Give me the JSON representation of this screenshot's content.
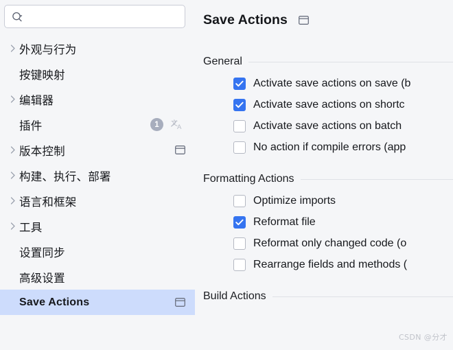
{
  "colors": {
    "background": "#f5f6f8",
    "selection": "#cddcfc",
    "accent": "#3574f0",
    "rule": "#dfe1e6",
    "badge": "#a7adbd",
    "text": "#16181c"
  },
  "sidebar": {
    "search": {
      "value": "",
      "placeholder": "",
      "icon": "search-icon",
      "dropdown_icon": "caret-down-icon"
    },
    "items": [
      {
        "label": "外观与行为",
        "expandable": true,
        "selected": false,
        "badge": null,
        "translate_icon": false,
        "panel_icon": false
      },
      {
        "label": "按键映射",
        "expandable": false,
        "selected": false,
        "badge": null,
        "translate_icon": false,
        "panel_icon": false
      },
      {
        "label": "编辑器",
        "expandable": true,
        "selected": false,
        "badge": null,
        "translate_icon": false,
        "panel_icon": false
      },
      {
        "label": "插件",
        "expandable": false,
        "selected": false,
        "badge": "1",
        "translate_icon": true,
        "panel_icon": false
      },
      {
        "label": "版本控制",
        "expandable": true,
        "selected": false,
        "badge": null,
        "translate_icon": false,
        "panel_icon": true
      },
      {
        "label": "构建、执行、部署",
        "expandable": true,
        "selected": false,
        "badge": null,
        "translate_icon": false,
        "panel_icon": false
      },
      {
        "label": "语言和框架",
        "expandable": true,
        "selected": false,
        "badge": null,
        "translate_icon": false,
        "panel_icon": false
      },
      {
        "label": "工具",
        "expandable": true,
        "selected": false,
        "badge": null,
        "translate_icon": false,
        "panel_icon": false
      },
      {
        "label": "设置同步",
        "expandable": false,
        "selected": false,
        "badge": null,
        "translate_icon": false,
        "panel_icon": false
      },
      {
        "label": "高级设置",
        "expandable": false,
        "selected": false,
        "badge": null,
        "translate_icon": false,
        "panel_icon": false
      },
      {
        "label": "Save Actions",
        "expandable": false,
        "selected": true,
        "badge": null,
        "translate_icon": false,
        "panel_icon": true,
        "latin": true
      }
    ]
  },
  "main": {
    "title": "Save Actions",
    "title_icon": "panel-icon",
    "sections": [
      {
        "title": "General",
        "options": [
          {
            "label": "Activate save actions on save (b",
            "checked": true
          },
          {
            "label": "Activate save actions on shortc",
            "checked": true
          },
          {
            "label": "Activate save actions on batch",
            "checked": false
          },
          {
            "label": "No action if compile errors (app",
            "checked": false
          }
        ]
      },
      {
        "title": "Formatting Actions",
        "options": [
          {
            "label": "Optimize imports",
            "checked": false
          },
          {
            "label": "Reformat file",
            "checked": true
          },
          {
            "label": "Reformat only changed code (o",
            "checked": false
          },
          {
            "label": "Rearrange fields and methods (",
            "checked": false
          }
        ]
      },
      {
        "title": "Build Actions",
        "options": []
      }
    ]
  },
  "watermark": "CSDN @分才"
}
